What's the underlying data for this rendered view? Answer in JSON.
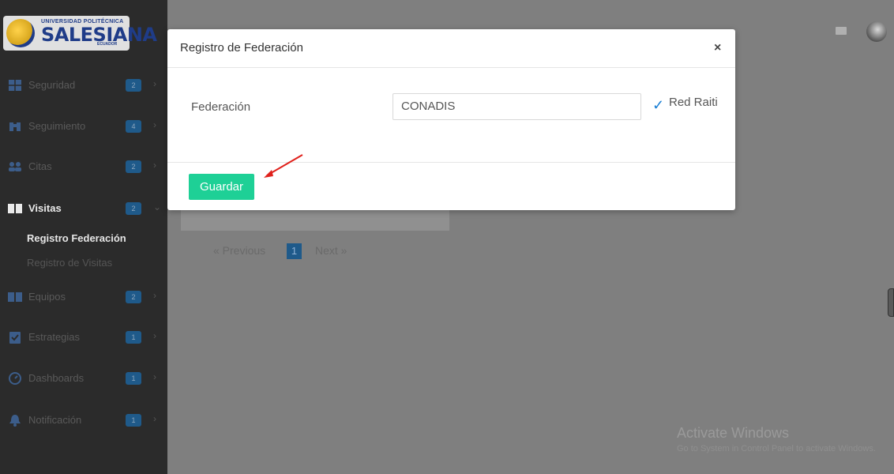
{
  "brand": {
    "top_text": "UNIVERSIDAD POLITÉCNICA",
    "name": "SALESIANA",
    "country": "ECUADOR"
  },
  "sidebar": {
    "items": [
      {
        "label": "Seguridad",
        "badge": "2",
        "icon": "grid-icon"
      },
      {
        "label": "Seguimiento",
        "badge": "4",
        "icon": "binoculars-icon"
      },
      {
        "label": "Citas",
        "badge": "2",
        "icon": "people-icon"
      },
      {
        "label": "Visitas",
        "badge": "2",
        "icon": "book-icon"
      },
      {
        "label": "Equipos",
        "badge": "2",
        "icon": "book-icon"
      },
      {
        "label": "Estrategias",
        "badge": "1",
        "icon": "clipboard-check-icon"
      },
      {
        "label": "Dashboards",
        "badge": "1",
        "icon": "gauge-icon"
      },
      {
        "label": "Notificación",
        "badge": "1",
        "icon": "bell-icon"
      }
    ],
    "submenu": {
      "active": "Registro Federación",
      "inactive": "Registro de Visitas"
    }
  },
  "modal": {
    "title": "Registro de Federación",
    "close": "×",
    "field_label": "Federación",
    "field_value": "CONADIS",
    "check_text": "Red Raiti",
    "save_label": "Guardar"
  },
  "pagination": {
    "previous": "« Previous",
    "page": "1",
    "next": "Next »"
  },
  "activate": {
    "title": "Activate Windows",
    "subtitle": "Go to System in Control Panel to activate Windows."
  }
}
